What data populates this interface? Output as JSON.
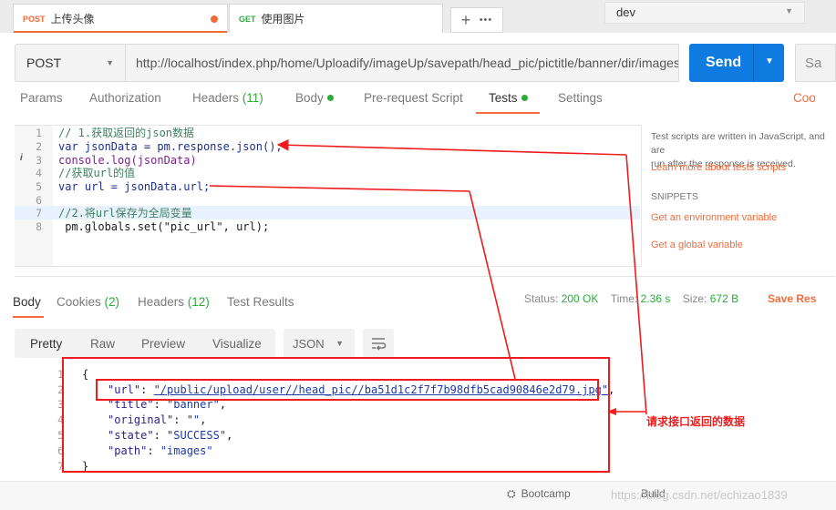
{
  "tabs": [
    {
      "method": "POST",
      "label": "上传头像",
      "method_color": "#f26b3a",
      "active": true
    },
    {
      "method": "GET",
      "label": "使用图片",
      "method_color": "#2bab3a",
      "active": false
    }
  ],
  "tab_actions": {
    "new": "+",
    "more": "•••"
  },
  "environment": {
    "value": "dev"
  },
  "request": {
    "method": "POST",
    "url": "http://localhost/index.php/home/Uploadify/imageUp/savepath/head_pic/pictitle/banner/dir/images",
    "send_label": "Send",
    "save_label": "Sa"
  },
  "request_tabs": {
    "params": "Params",
    "authorization": "Authorization",
    "headers": "Headers",
    "headers_count": "(11)",
    "body": "Body",
    "pre_request": "Pre-request Script",
    "tests": "Tests",
    "settings": "Settings",
    "cookies_link": "Coo"
  },
  "script_lines": [
    {
      "n": "1",
      "text": "// 1.获取返回的json数据",
      "color": "#3f7f5f"
    },
    {
      "n": "2",
      "text": "var jsonData = pm.response.json();",
      "color": "#1c2f8c"
    },
    {
      "n": "3",
      "text": "console.log(jsonData)",
      "color": "#7a1f8a"
    },
    {
      "n": "4",
      "text": "//获取url的值",
      "color": "#3f7f5f"
    },
    {
      "n": "5",
      "text": "var url = jsonData.url;",
      "color": "#1c2f8c"
    },
    {
      "n": "6",
      "text": "",
      "color": "#1c2f8c"
    },
    {
      "n": "7",
      "text": "//2.将url保存为全局变量",
      "color": "#3f7f5f"
    },
    {
      "n": "8",
      "text": " pm.globals.set(\"pic_url\", url);",
      "color": "#1a1a1a"
    }
  ],
  "info_marker": "i",
  "side_panel": {
    "hint_line1": "Test scripts are written in JavaScript, and are",
    "hint_line2": "run after the response is received.",
    "learn_more": "Learn more about tests scripts",
    "snippets_title": "SNIPPETS",
    "snippet1": "Get an environment variable",
    "snippet2": "Get a global variable"
  },
  "response_tabs": {
    "body": "Body",
    "cookies": "Cookies",
    "cookies_count": "(2)",
    "headers": "Headers",
    "headers_count": "(12)",
    "test_results": "Test Results"
  },
  "response_meta": {
    "status_label": "Status:",
    "status_value": "200 OK",
    "time_label": "Time:",
    "time_value": "2.36 s",
    "size_label": "Size:",
    "size_value": "672 B",
    "save_response": "Save Res"
  },
  "view_options": {
    "pretty": "Pretty",
    "raw": "Raw",
    "preview": "Preview",
    "visualize": "Visualize",
    "format": "JSON"
  },
  "response_json": [
    {
      "n": "1",
      "text": "{"
    },
    {
      "n": "2",
      "key": "\"url\"",
      "value": "\"/public/upload/user//head_pic//ba51d1c2f7f7b98dfb5cad90846e2d79.jpg\"",
      "suffix": ","
    },
    {
      "n": "3",
      "key": "\"title\"",
      "value": "\"banner\"",
      "suffix": ","
    },
    {
      "n": "4",
      "key": "\"original\"",
      "value": "\"\"",
      "suffix": ","
    },
    {
      "n": "5",
      "key": "\"state\"",
      "value": "\"SUCCESS\"",
      "suffix": ","
    },
    {
      "n": "6",
      "key": "\"path\"",
      "value": "\"images\"",
      "suffix": ""
    },
    {
      "n": "7",
      "text": "}"
    }
  ],
  "annotation": {
    "text": "请求接口返回的数据",
    "color": "#ee1c1c"
  },
  "footer": {
    "bootcamp": "Bootcamp",
    "build": "Build",
    "watermark": "https://blog.csdn.net/echizao1839"
  }
}
